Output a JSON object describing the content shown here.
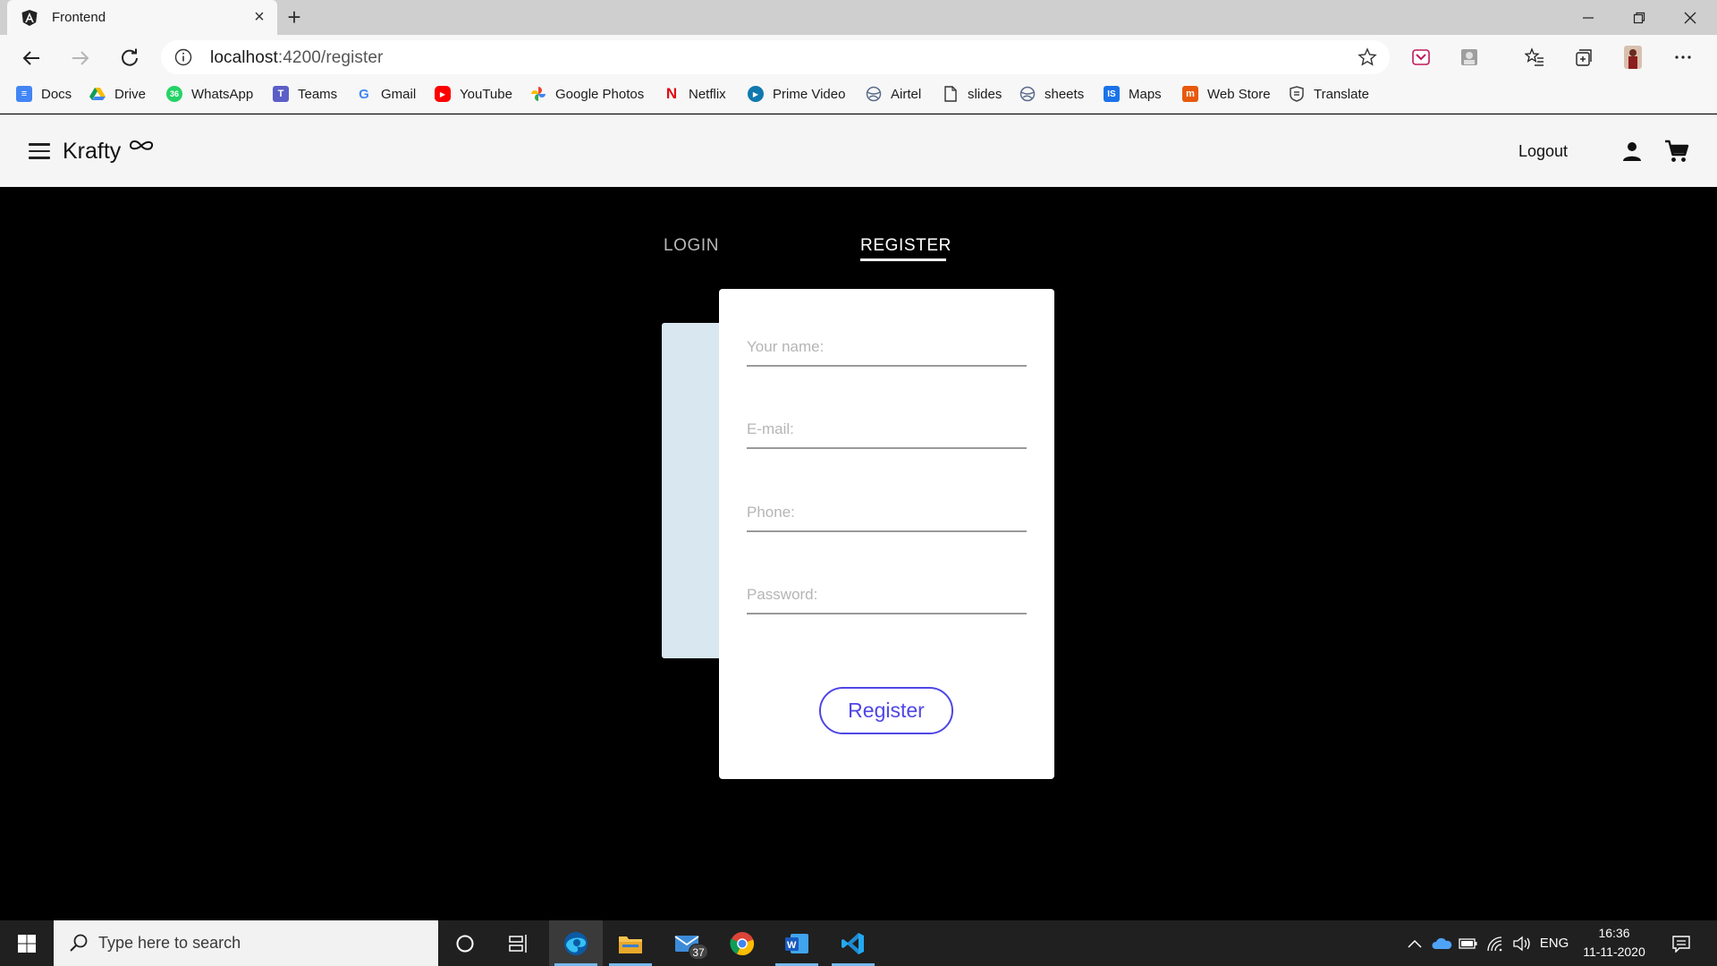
{
  "browser": {
    "tab_title": "Frontend",
    "url_host": "localhost",
    "url_path": ":4200/register",
    "bookmarks": [
      {
        "label": "Docs",
        "icon": "docs-icon",
        "color": "#4285f4"
      },
      {
        "label": "Drive",
        "icon": "drive-icon",
        "color": "#fbbc04"
      },
      {
        "label": "WhatsApp",
        "icon": "whatsapp-icon",
        "color": "#25d366",
        "badge": "36"
      },
      {
        "label": "Teams",
        "icon": "teams-icon",
        "color": "#5b5fc7"
      },
      {
        "label": "Gmail",
        "icon": "google-icon",
        "color": "#ea4335"
      },
      {
        "label": "YouTube",
        "icon": "youtube-icon",
        "color": "#ff0000"
      },
      {
        "label": "Google Photos",
        "icon": "photos-icon",
        "color": "#fbbc04"
      },
      {
        "label": "Netflix",
        "icon": "netflix-icon",
        "color": "#e50914"
      },
      {
        "label": "Prime Video",
        "icon": "prime-video-icon",
        "color": "#1a98ff"
      },
      {
        "label": "Airtel",
        "icon": "globe-icon",
        "color": "#5a6a8a"
      },
      {
        "label": "slides",
        "icon": "page-icon",
        "color": "#333333"
      },
      {
        "label": "sheets",
        "icon": "globe-icon",
        "color": "#5a6a8a"
      },
      {
        "label": "Maps",
        "icon": "maps-icon",
        "color": "#1a73e8"
      },
      {
        "label": "Web Store",
        "icon": "web-store-icon",
        "color": "#e8590c"
      },
      {
        "label": "Translate",
        "icon": "translate-icon",
        "color": "#444444"
      }
    ]
  },
  "app": {
    "brand": "Krafty",
    "logout_label": "Logout",
    "tabs": {
      "login": "LOGIN",
      "register": "REGISTER"
    },
    "form": {
      "name_placeholder": "Your name:",
      "email_placeholder": "E-mail:",
      "phone_placeholder": "Phone:",
      "password_placeholder": "Password:",
      "submit_label": "Register"
    },
    "accent_color": "#4f46e5"
  },
  "taskbar": {
    "search_placeholder": "Type here to search",
    "mail_badge": "37",
    "language": "ENG",
    "time": "16:36",
    "date": "11-11-2020"
  }
}
